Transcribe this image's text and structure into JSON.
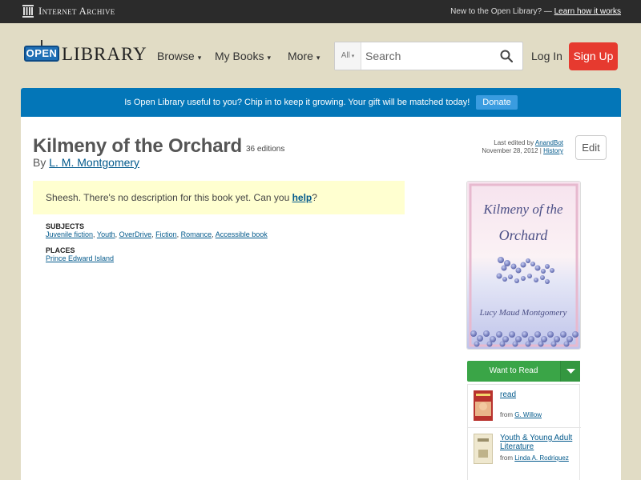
{
  "ia_bar": {
    "logo_text": "Internet Archive",
    "new_text": "New to the Open Library? — ",
    "learn_link": "Learn how it works"
  },
  "header": {
    "logo_open": "OPEN",
    "logo_library": "LIBRARY",
    "nav": [
      {
        "label": "Browse"
      },
      {
        "label": "My Books"
      },
      {
        "label": "More"
      }
    ],
    "search": {
      "scope": "All",
      "placeholder": "Search"
    },
    "login": "Log In",
    "signup": "Sign Up"
  },
  "donate": {
    "message": "Is Open Library useful to you? Chip in to keep it growing. Your gift will be matched today!",
    "button": "Donate"
  },
  "book": {
    "title": "Kilmeny of the Orchard",
    "editions": "36 editions",
    "by": "By",
    "author": "L. M. Montgomery",
    "last_edited_prefix": "Last edited by ",
    "last_edited_by": "AnandBot",
    "last_edited_date": "November 28, 2012 | ",
    "history": "History",
    "edit": "Edit",
    "description_prefix": "Sheesh. There's no description for this book yet. Can you ",
    "description_link": "help",
    "description_suffix": "?",
    "subjects_heading": "SUBJECTS",
    "subjects": [
      "Juvenile fiction",
      "Youth",
      "OverDrive",
      "Fiction",
      "Romance",
      "Accessible book"
    ],
    "places_heading": "PLACES",
    "places": [
      "Prince Edward Island"
    ],
    "cover": {
      "title_line1": "Kilmeny of the",
      "title_line2": "Orchard",
      "author": "Lucy Maud Montgomery"
    }
  },
  "sidebar": {
    "want_to_read": "Want to Read",
    "lists": [
      {
        "name": "read",
        "from_prefix": "from ",
        "from": "G. Willow"
      },
      {
        "name": "Youth & Young Adult Literature",
        "from_prefix": "from ",
        "from": "Linda A. Rodriquez"
      }
    ]
  },
  "colors": {
    "donate_bar": "#0376b8",
    "signup": "#e63a2f",
    "want_to_read": "#3aa547",
    "description_bg": "#ffffd0"
  },
  "icons": [
    "columns-icon",
    "search-icon",
    "chevron-down-icon"
  ]
}
